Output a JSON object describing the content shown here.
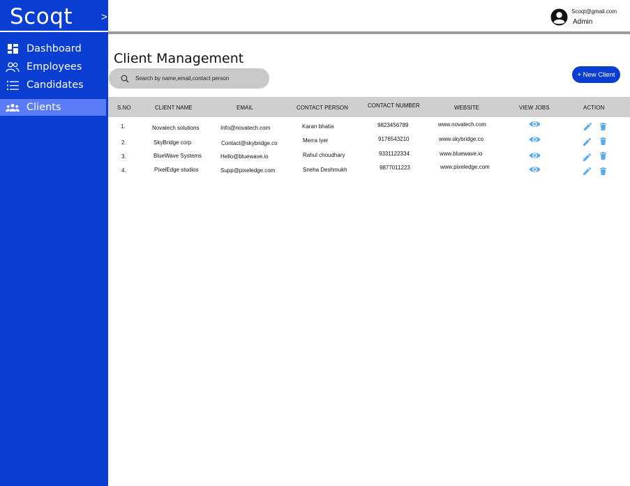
{
  "app": {
    "brand": "Scoqt",
    "collapse_label": ">"
  },
  "sidebar": {
    "items": [
      {
        "label": "Dashboard",
        "icon": "dashboard-icon",
        "active": false
      },
      {
        "label": "Employees",
        "icon": "employees-icon",
        "active": false
      },
      {
        "label": "Candidates",
        "icon": "list-icon",
        "active": false
      },
      {
        "label": "Clients",
        "icon": "clients-icon",
        "active": true
      }
    ]
  },
  "header": {
    "user_email": "Scoqt@gmail.com",
    "user_role": "Admin"
  },
  "main": {
    "title": "Client Management",
    "search_placeholder": "Search by name,email,contact person",
    "new_client_label": "+ New Client"
  },
  "table": {
    "columns": [
      "S.NO",
      "CLIENT NAME",
      "EMAIL",
      "CONTACT PERSON",
      "CONTACT NUMBER",
      "WEBSITE",
      "VIEW JOBS",
      "ACTION"
    ],
    "rows": [
      {
        "sno": "1.",
        "client_name": "Novatech solutions",
        "email": "Info@novatech.com",
        "contact_person": "Karan bhatia",
        "contact_number": "9823456789",
        "website": "www.novatech.com"
      },
      {
        "sno": "2.",
        "client_name": "SkyBridge corp",
        "email": "Contact@skybridge.co",
        "contact_person": "Merra Iyer",
        "contact_number": "9176543210",
        "website": "www.skybridge.co"
      },
      {
        "sno": "3.",
        "client_name": "BlueWave Systems",
        "email": "Hello@bluewave.io",
        "contact_person": "Rahul choudhary",
        "contact_number": "9331122334",
        "website": "www.bluewave.io"
      },
      {
        "sno": "4.",
        "client_name": "PixelEdge studios",
        "email": "Supp@pixeledge.com",
        "contact_person": "Sneha Deshmukh",
        "contact_number": "9877011223",
        "website": "www.pixeledge.com"
      }
    ]
  },
  "colors": {
    "sidebar": "#0a3dd1",
    "sidebar_active": "#5b7cf7",
    "accent": "#0a3dd1",
    "table_header": "#cfcfcf",
    "icon_action": "#5aa8f0"
  }
}
